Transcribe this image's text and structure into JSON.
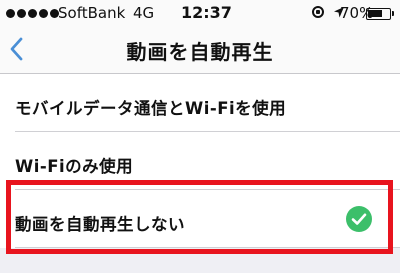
{
  "status_bar": {
    "carrier": "SoftBank",
    "network": "4G",
    "time": "12:37",
    "battery": "70%",
    "battery_level": 0.7,
    "signal_dots": 5,
    "icons": [
      "signal-dots-icon",
      "rotation-lock-icon",
      "location-arrow-icon",
      "battery-icon"
    ]
  },
  "nav": {
    "back_icon": "chevron-left-icon",
    "title": "動画を自動再生"
  },
  "options": [
    {
      "label": "モバイルデータ通信とWi-Fiを使用",
      "selected": false
    },
    {
      "label": "Wi-Fiのみ使用",
      "selected": false
    },
    {
      "label": "動画を自動再生しない",
      "selected": true
    }
  ],
  "colors": {
    "accent_blue": "#4a8fd6",
    "check_green": "#3cbf6a",
    "highlight_red": "#e8141e"
  }
}
